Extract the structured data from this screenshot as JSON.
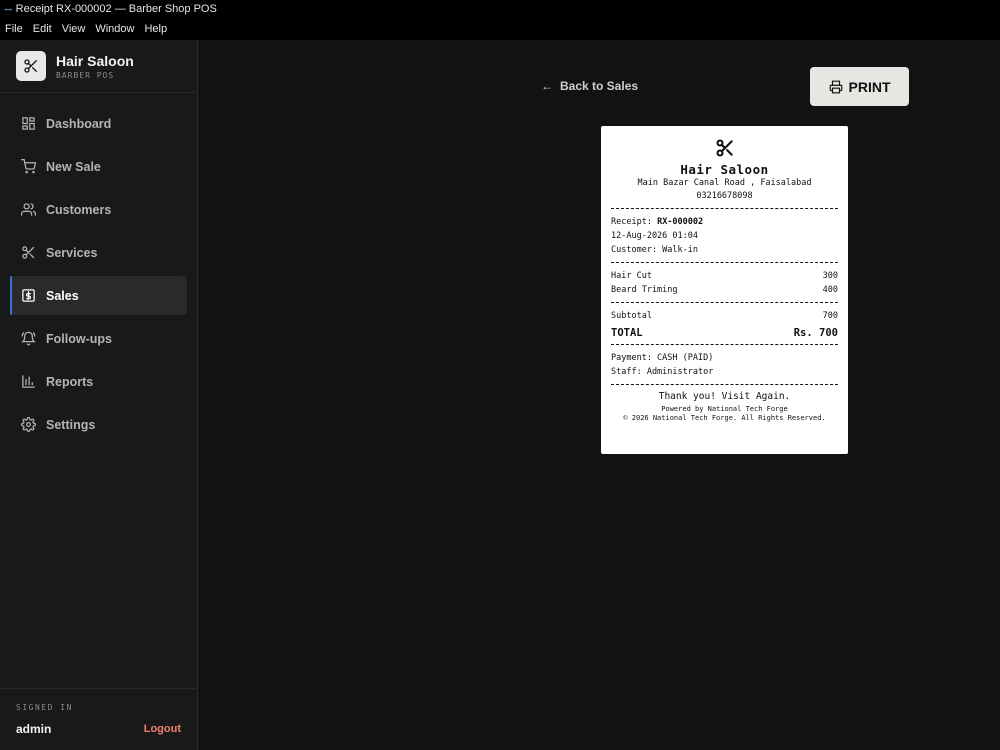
{
  "window": {
    "title": "Receipt RX-000002 — Barber Shop POS",
    "icon": "app-icon"
  },
  "menu": [
    "File",
    "Edit",
    "View",
    "Window",
    "Help"
  ],
  "brand": {
    "name": "Hair Saloon",
    "subtitle": "BARBER POS"
  },
  "sidebar": {
    "items": [
      {
        "label": "Dashboard",
        "icon": "dashboard-icon"
      },
      {
        "label": "New Sale",
        "icon": "cart-icon"
      },
      {
        "label": "Customers",
        "icon": "users-icon"
      },
      {
        "label": "Services",
        "icon": "scissors-icon"
      },
      {
        "label": "Sales",
        "icon": "dollar-icon",
        "active": true
      },
      {
        "label": "Follow-ups",
        "icon": "bell-icon"
      },
      {
        "label": "Reports",
        "icon": "chart-icon"
      },
      {
        "label": "Settings",
        "icon": "gear-icon"
      }
    ],
    "active_accent": "#3f6fd8"
  },
  "session": {
    "label": "SIGNED IN",
    "user": "admin",
    "logout": "Logout"
  },
  "actions": {
    "back": "Back to Sales",
    "print": "PRINT"
  },
  "receipt": {
    "shop_name": "Hair Saloon",
    "address": "Main Bazar Canal Road , Faisalabad",
    "phone": "03216678098",
    "receipt_label": "Receipt:",
    "receipt_no": "RX-000002",
    "datetime": "12-Aug-2026 01:04",
    "customer": "Customer: Walk-in",
    "items": [
      {
        "name": "Hair Cut",
        "amount": "300"
      },
      {
        "name": "Beard Triming",
        "amount": "400"
      }
    ],
    "subtotal_label": "Subtotal",
    "subtotal": "700",
    "total_label": "TOTAL",
    "total": "Rs. 700",
    "payment": "Payment: CASH (PAID)",
    "staff": "Staff: Administrator",
    "thanks": "Thank you! Visit Again.",
    "powered": "Powered by National Tech Forge",
    "copyright": "© 2026 National Tech Forge. All Rights Reserved."
  }
}
